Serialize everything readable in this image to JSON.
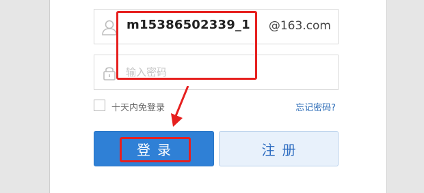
{
  "login": {
    "username_value": "m15386502339_1",
    "domain_suffix": "@163.com",
    "password_placeholder": "输入密码",
    "remember_label": "十天内免登录",
    "forgot_link": "忘记密码?",
    "login_button": "登录",
    "register_button": "注册"
  },
  "icons": {
    "user": "user-icon",
    "lock": "lock-icon"
  },
  "colors": {
    "primary": "#2f80d6",
    "secondary_bg": "#e8f1fb",
    "link": "#2c6cb7",
    "annotation": "#e6201f"
  }
}
